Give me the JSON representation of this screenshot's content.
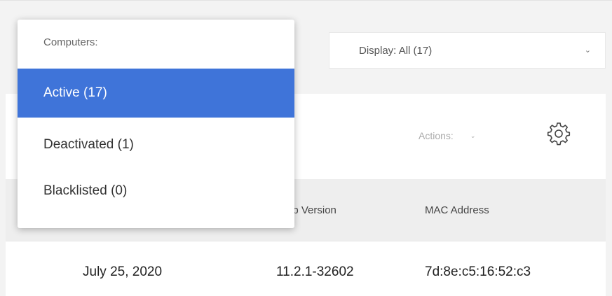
{
  "display_filter": {
    "label": "Display: All (17)",
    "chevron": "chevron-down-icon"
  },
  "computers_menu": {
    "heading": "Computers:",
    "items": [
      {
        "label": "Active (17)",
        "selected": true
      },
      {
        "label": "Deactivated (1)",
        "selected": false
      },
      {
        "label": "Blacklisted (0)",
        "selected": false
      }
    ]
  },
  "toolbar": {
    "actions_label": "Actions:",
    "settings_icon": "gear-icon"
  },
  "table": {
    "headers": {
      "app_version": "pp Version",
      "mac_address": "MAC Address"
    },
    "rows": [
      {
        "date": "July 25, 2020",
        "app_version": "11.2.1-32602",
        "mac_address": "7d:8e:c5:16:52:c3"
      }
    ]
  },
  "colors": {
    "selected": "#3f74d9",
    "background": "#f3f3f3",
    "header_row": "#eeeeee"
  }
}
